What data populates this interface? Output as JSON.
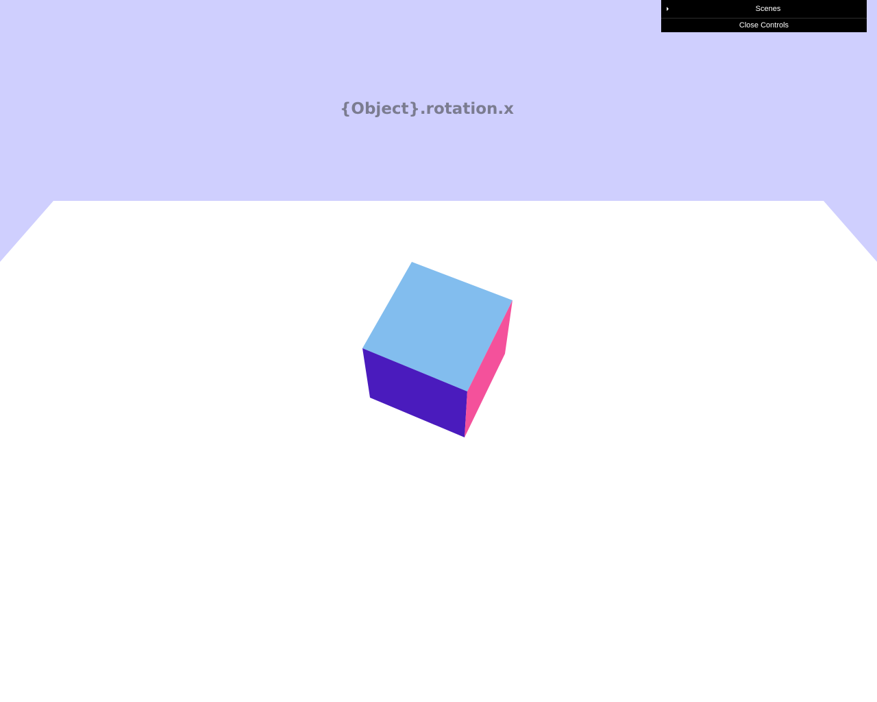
{
  "scene": {
    "title": "{Object}.rotation.x",
    "colors": {
      "sky": "#cfcffe",
      "floor": "#ffffff",
      "cube_top": "#82bdee",
      "cube_front": "#4a1bbd",
      "cube_side": "#f4519b",
      "title_text": "#7b7c90"
    }
  },
  "controls": {
    "folders": [
      {
        "label": "Scenes",
        "icon": "triangle-right-icon",
        "collapsed": true
      }
    ],
    "close_label": "Close Controls",
    "colors": {
      "panel_bg": "#000000",
      "panel_text": "#ffffff"
    }
  }
}
